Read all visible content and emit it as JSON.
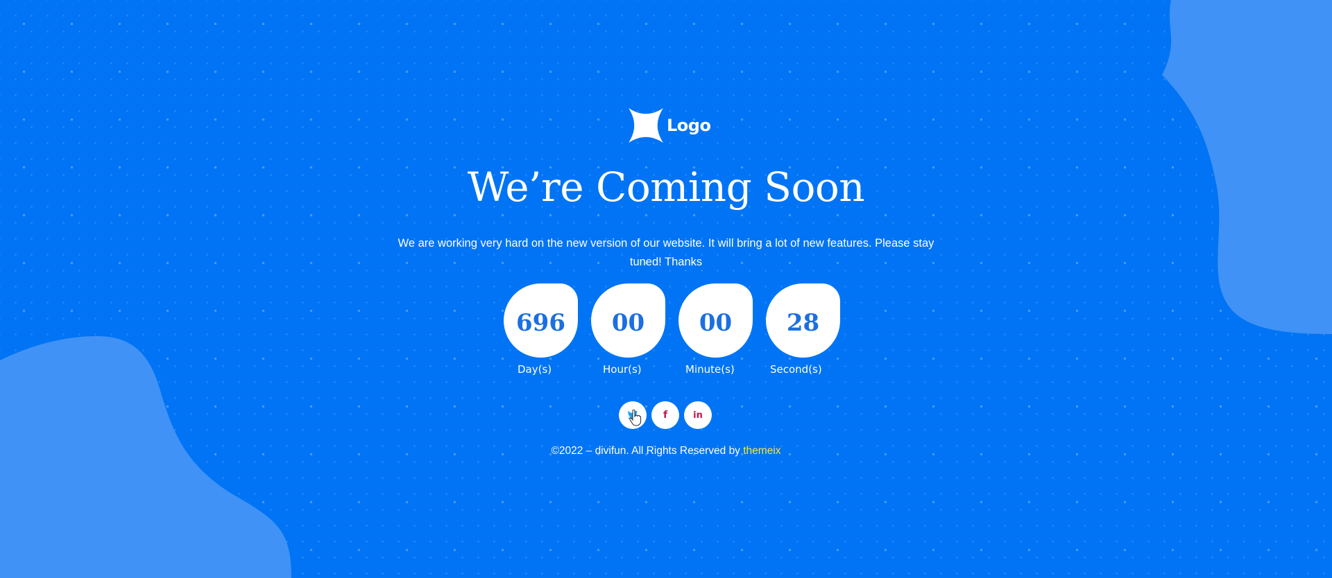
{
  "colors": {
    "background": "#0074f4",
    "blob": "#4092f6",
    "countdown_value": "#1b6fe0",
    "credit_link": "#f2ea3a"
  },
  "logo": {
    "icon": "four-point-star-icon",
    "text": "Logo"
  },
  "headline": "We’re Coming Soon",
  "subtext": "We are working very hard on the new version of our website. It will bring a  lot of new features. Please stay tuned! Thanks",
  "countdown": [
    {
      "value": "696",
      "label": "Day(s)"
    },
    {
      "value": "00",
      "label": "Hour(s)"
    },
    {
      "value": "00",
      "label": "Minute(s)"
    },
    {
      "value": "28",
      "label": "Second(s)"
    }
  ],
  "social": [
    {
      "name": "twitter",
      "icon": "twitter-bird-icon",
      "glyph": "🐦"
    },
    {
      "name": "facebook",
      "icon": "facebook-icon",
      "glyph": "f"
    },
    {
      "name": "linkedin",
      "icon": "linkedin-icon",
      "glyph": "in"
    }
  ],
  "footer": {
    "text": "©2022 – divifun. All Rights Reserved by ",
    "link_text": "themeix"
  }
}
